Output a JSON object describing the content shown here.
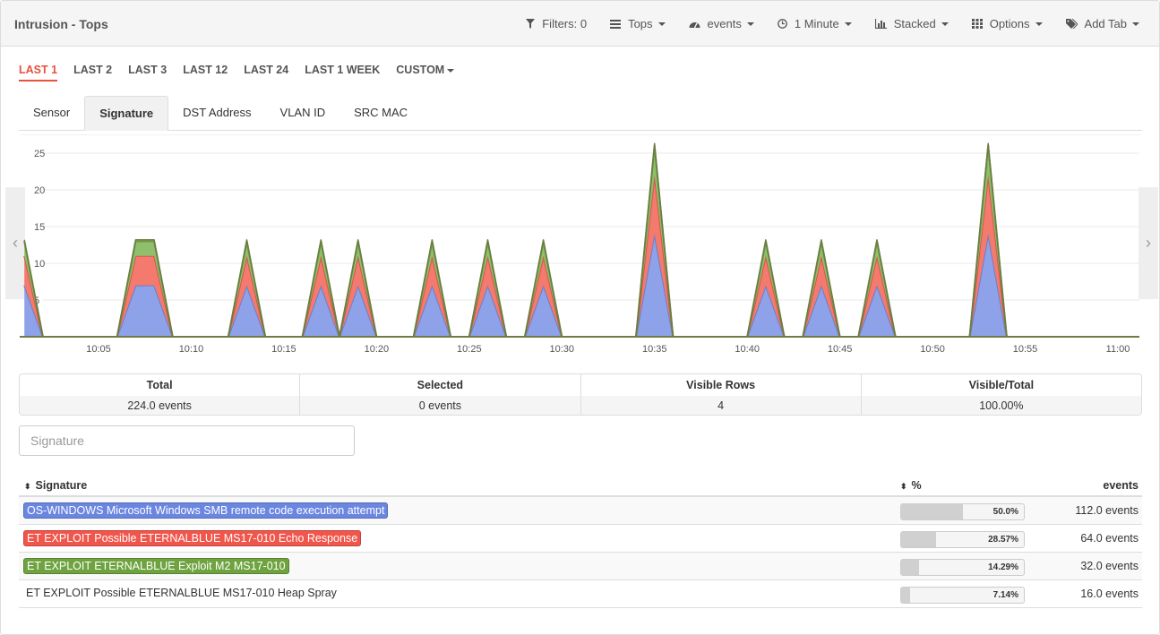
{
  "header": {
    "title": "Intrusion - Tops",
    "toolbar": [
      {
        "name": "filters",
        "icon": "filter-icon",
        "label": "Filters: 0",
        "dropdown": false
      },
      {
        "name": "tops",
        "icon": "list-icon",
        "label": "Tops",
        "dropdown": true
      },
      {
        "name": "events",
        "icon": "dashboard-icon",
        "label": "events",
        "dropdown": true
      },
      {
        "name": "interval",
        "icon": "clock-icon",
        "label": "1 Minute",
        "dropdown": true
      },
      {
        "name": "stacked",
        "icon": "bar-chart-icon",
        "label": "Stacked",
        "dropdown": true
      },
      {
        "name": "options",
        "icon": "grid-icon",
        "label": "Options",
        "dropdown": true
      },
      {
        "name": "add-tab",
        "icon": "tags-icon",
        "label": "Add Tab",
        "dropdown": true
      }
    ]
  },
  "ranges": [
    {
      "label": "LAST 1",
      "active": true
    },
    {
      "label": "LAST 2",
      "active": false
    },
    {
      "label": "LAST 3",
      "active": false
    },
    {
      "label": "LAST 12",
      "active": false
    },
    {
      "label": "LAST 24",
      "active": false
    },
    {
      "label": "LAST 1 WEEK",
      "active": false
    },
    {
      "label": "CUSTOM",
      "active": false,
      "dropdown": true
    }
  ],
  "tabs": [
    {
      "label": "Sensor",
      "active": false
    },
    {
      "label": "Signature",
      "active": true
    },
    {
      "label": "DST Address",
      "active": false
    },
    {
      "label": "VLAN ID",
      "active": false
    },
    {
      "label": "SRC MAC",
      "active": false
    }
  ],
  "chart_data": {
    "type": "area",
    "stacked": true,
    "title": "",
    "xlabel": "",
    "ylabel": "",
    "x_unit": "minutes after 10:00",
    "xlim": [
      1,
      61
    ],
    "ylim": [
      0,
      26
    ],
    "yticks": [
      5,
      10,
      15,
      20,
      25
    ],
    "xticks": [
      "10:05",
      "10:10",
      "10:15",
      "10:20",
      "10:25",
      "10:30",
      "10:35",
      "10:40",
      "10:45",
      "10:50",
      "10:55",
      "11:00"
    ],
    "grid": true,
    "x": [
      1,
      2,
      6,
      7,
      8,
      9,
      12,
      13,
      14,
      16,
      17,
      18,
      19,
      20,
      22,
      23,
      24,
      25,
      26,
      27,
      28,
      29,
      30,
      34,
      35,
      36,
      40,
      41,
      42,
      43,
      44,
      45,
      46,
      47,
      48,
      52,
      53,
      54,
      61
    ],
    "series": [
      {
        "name": "OS-WINDOWS Microsoft Windows SMB remote code execution attempt",
        "color": "#8da2e8",
        "values": [
          7,
          0,
          0,
          7,
          7,
          0,
          0,
          7,
          0,
          0,
          7,
          0,
          7,
          0,
          0,
          7,
          0,
          0,
          7,
          0,
          0,
          7,
          0,
          0,
          14,
          0,
          0,
          7,
          0,
          0,
          7,
          0,
          0,
          7,
          0,
          0,
          14,
          0,
          0
        ]
      },
      {
        "name": "ET EXPLOIT Possible ETERNALBLUE MS17-010 Echo Response",
        "color": "#f47a6e",
        "values": [
          4,
          0,
          0,
          4,
          4,
          0,
          0,
          4,
          0,
          0,
          4,
          0,
          4,
          0,
          0,
          4,
          0,
          0,
          4,
          0,
          0,
          4,
          0,
          0,
          8,
          0,
          0,
          4,
          0,
          0,
          4,
          0,
          0,
          4,
          0,
          0,
          8,
          0,
          0
        ]
      },
      {
        "name": "ET EXPLOIT ETERNALBLUE Exploit M2 MS17-010",
        "color": "#8fbf6a",
        "values": [
          2,
          0,
          0,
          2,
          2,
          0,
          0,
          2,
          0,
          0,
          2,
          0,
          2,
          0,
          0,
          2,
          0,
          0,
          2,
          0,
          0,
          2,
          0,
          0,
          4,
          0,
          0,
          2,
          0,
          0,
          2,
          0,
          0,
          2,
          0,
          0,
          4,
          0,
          0
        ]
      },
      {
        "name": "ET EXPLOIT Possible ETERNALBLUE MS17-010 Heap Spray",
        "color": "#8a9a5b",
        "values": [
          0.2,
          0,
          0,
          0.2,
          0.2,
          0,
          0,
          0.2,
          0,
          0,
          0.2,
          0,
          0.2,
          0,
          0,
          0.2,
          0,
          0,
          0.2,
          0,
          0,
          0.2,
          0,
          0,
          0.3,
          0,
          0,
          0.2,
          0,
          0,
          0.2,
          0,
          0,
          0.2,
          0,
          0,
          0.3,
          0,
          0
        ]
      }
    ],
    "stroke_colors": [
      "#6b7fc8",
      "#d9534f",
      "#5f9a3b",
      "#6e7b45"
    ]
  },
  "stats": [
    {
      "label": "Total",
      "value": "224.0 events"
    },
    {
      "label": "Selected",
      "value": "0 events"
    },
    {
      "label": "Visible Rows",
      "value": "4"
    },
    {
      "label": "Visible/Total",
      "value": "100.00%"
    }
  ],
  "filter": {
    "placeholder": "Signature",
    "value": ""
  },
  "table": {
    "columns": [
      "Signature",
      "%",
      "events"
    ],
    "rows": [
      {
        "signature": "OS-WINDOWS Microsoft Windows SMB remote code execution attempt",
        "color": "#6b86e0",
        "percent": 50.0,
        "percent_label": "50.0%",
        "events": "112.0 events"
      },
      {
        "signature": "ET EXPLOIT Possible ETERNALBLUE MS17-010 Echo Response",
        "color": "#f0564b",
        "percent": 28.57,
        "percent_label": "28.57%",
        "events": "64.0 events"
      },
      {
        "signature": "ET EXPLOIT ETERNALBLUE Exploit M2 MS17-010",
        "color": "#6ea33f",
        "percent": 14.29,
        "percent_label": "14.29%",
        "events": "32.0 events"
      },
      {
        "signature": "ET EXPLOIT Possible ETERNALBLUE MS17-010 Heap Spray",
        "color": "",
        "percent": 7.14,
        "percent_label": "7.14%",
        "events": "16.0 events"
      }
    ]
  }
}
